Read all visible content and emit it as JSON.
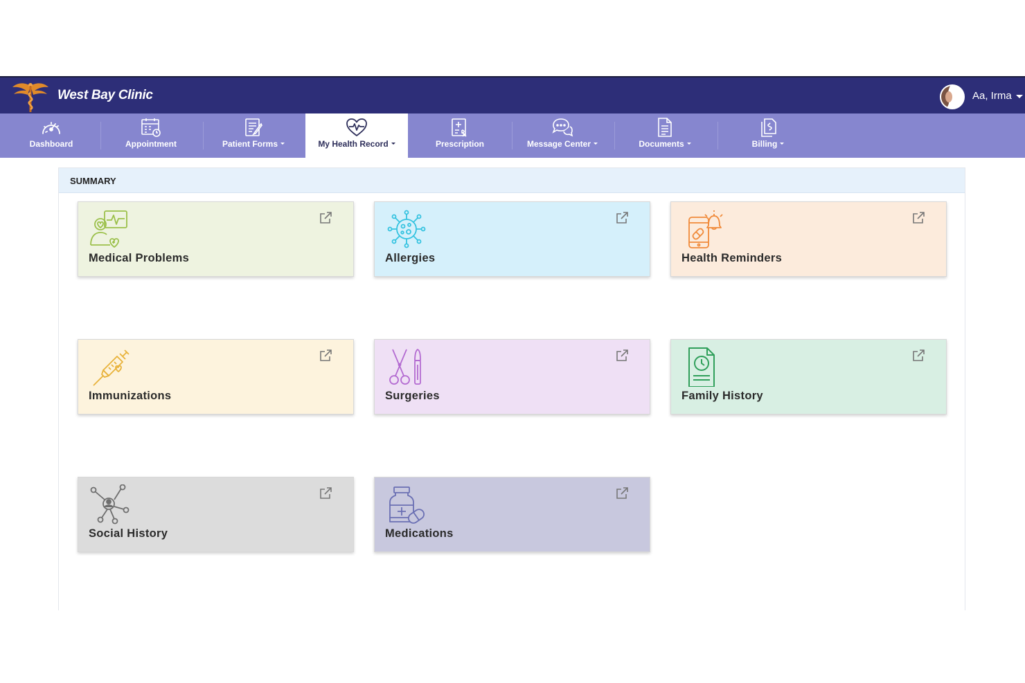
{
  "header": {
    "clinic_name": "West Bay Clinic",
    "user_name": "Aa, Irma",
    "bar_color": "#2d2e78",
    "logo_icon": "caduceus-icon"
  },
  "nav": {
    "bar_color": "#8686cf",
    "items": [
      {
        "label": "Dashboard",
        "icon": "speedometer-icon",
        "dropdown": false,
        "active": false
      },
      {
        "label": "Appointment",
        "icon": "calendar-clock-icon",
        "dropdown": false,
        "active": false
      },
      {
        "label": "Patient Forms",
        "icon": "form-edit-icon",
        "dropdown": true,
        "active": false
      },
      {
        "label": "My Health Record",
        "icon": "heartbeat-icon",
        "dropdown": true,
        "active": true
      },
      {
        "label": "Prescription",
        "icon": "prescription-icon",
        "dropdown": false,
        "active": false
      },
      {
        "label": "Message Center",
        "icon": "chat-bubbles-icon",
        "dropdown": true,
        "active": false
      },
      {
        "label": "Documents",
        "icon": "document-icon",
        "dropdown": true,
        "active": false
      },
      {
        "label": "Billing",
        "icon": "billing-icon",
        "dropdown": true,
        "active": false
      }
    ]
  },
  "summary": {
    "title": "SUMMARY",
    "cards": [
      {
        "title": "Medical Problems",
        "icon": "medical-problems-icon",
        "bg": "#eef3e0",
        "icon_color": "#9bc04a"
      },
      {
        "title": "Allergies",
        "icon": "virus-icon",
        "bg": "#d5f0fb",
        "icon_color": "#35c3e0"
      },
      {
        "title": "Health Reminders",
        "icon": "phone-bell-icon",
        "bg": "#fcebdc",
        "icon_color": "#f08a3a"
      },
      {
        "title": "Immunizations",
        "icon": "syringe-icon",
        "bg": "#fdf3dd",
        "icon_color": "#e8b23a"
      },
      {
        "title": "Surgeries",
        "icon": "scissors-scalpel-icon",
        "bg": "#efe0f5",
        "icon_color": "#b36ad1"
      },
      {
        "title": "Family History",
        "icon": "clock-document-icon",
        "bg": "#d8efe3",
        "icon_color": "#2f9f5a"
      },
      {
        "title": "Social History",
        "icon": "network-person-icon",
        "bg": "#dcdcdc",
        "icon_color": "#6e6e6e"
      },
      {
        "title": "Medications",
        "icon": "pill-bottle-icon",
        "bg": "#c8c8de",
        "icon_color": "#6a6fb3"
      }
    ]
  }
}
